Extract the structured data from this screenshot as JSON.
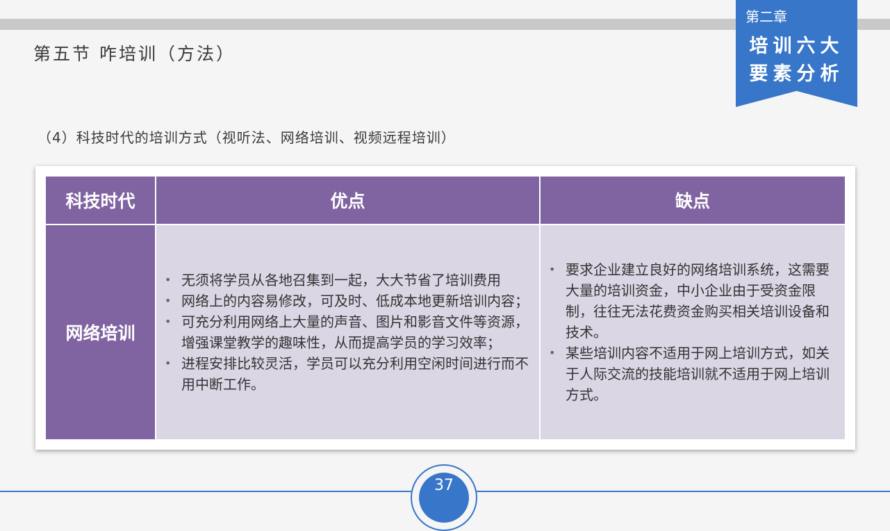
{
  "header": {
    "section_title": "第五节  咋培训（方法）",
    "chapter_label": "第二章",
    "chapter_name_line1": "培训六大",
    "chapter_name_line2": "要素分析"
  },
  "subtitle": "（4）科技时代的培训方式（视听法、网络培训、视频远程培训）",
  "table": {
    "headers": [
      "科技时代",
      "优点",
      "缺点"
    ],
    "row_label": "网络培训",
    "advantages": [
      "无须将学员从各地召集到一起，大大节省了培训费用",
      "网络上的内容易修改，可及时、低成本地更新培训内容；",
      "可充分利用网络上大量的声音、图片和影音文件等资源，增强课堂教学的趣味性，从而提高学员的学习效率；",
      "进程安排比较灵活，学员可以充分利用空闲时间进行而不用中断工作。"
    ],
    "disadvantages": [
      "要求企业建立良好的网络培训系统，这需要大量的培训资金，中小企业由于受资金限制，往往无法花费资金购买相关培训设备和技术。",
      "某些培训内容不适用于网上培训方式，如关于人际交流的技能培训就不适用于网上培训方式。"
    ]
  },
  "page_number": "37",
  "colors": {
    "accent_blue": "#3776c8",
    "header_purple": "#8064a2",
    "cell_lavender": "#dbd6e4"
  }
}
